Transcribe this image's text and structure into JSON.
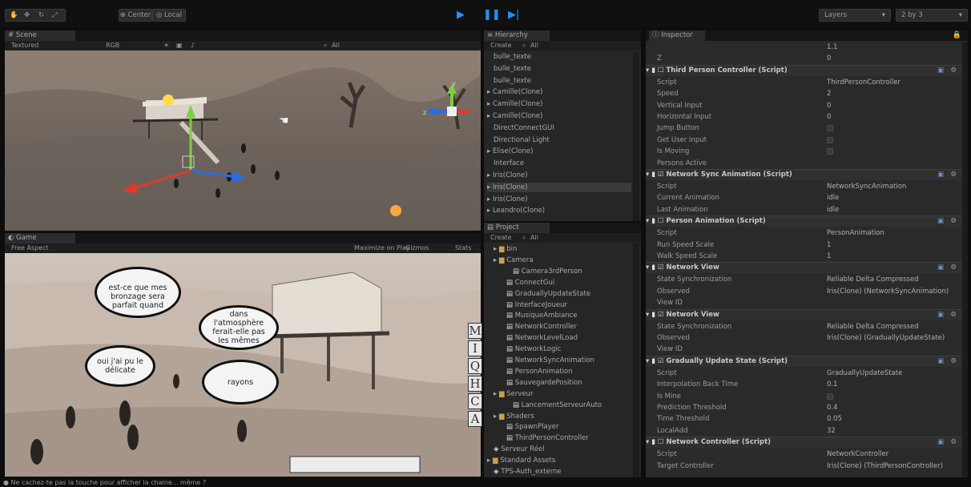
{
  "toolbar": {
    "pivot": "Center",
    "space": "Local",
    "layers": "Layers",
    "layout": "2 by 3"
  },
  "scene": {
    "tab": "Scene",
    "render_mode": "Textured",
    "color_mode": "RGB",
    "search": "All"
  },
  "game": {
    "tab": "Game",
    "aspect": "Free Aspect",
    "maximize": "Maximize on Play",
    "gizmos": "Gizmos",
    "stats": "Stats",
    "bubbles": [
      "est-ce que mes bronzage sera parfait quand",
      "dans l'atmosphère ferait-elle pas les mêmes",
      "oui j'ai pu le délicate",
      "rayons"
    ],
    "keys": [
      "M",
      "I",
      "Q",
      "H",
      "C",
      "A"
    ]
  },
  "hierarchy": {
    "tab": "Hierarchy",
    "create": "Create",
    "search": "All",
    "items": [
      {
        "label": "bulle_texte",
        "arrow": false,
        "selected": false
      },
      {
        "label": "bulle_texte",
        "arrow": false,
        "selected": false
      },
      {
        "label": "bulle_texte",
        "arrow": false,
        "selected": false
      },
      {
        "label": "Camille(Clone)",
        "arrow": true,
        "selected": false
      },
      {
        "label": "Camille(Clone)",
        "arrow": true,
        "selected": false
      },
      {
        "label": "Camille(Clone)",
        "arrow": true,
        "selected": false
      },
      {
        "label": "DirectConnectGUI",
        "arrow": false,
        "selected": false
      },
      {
        "label": "Directional Light",
        "arrow": false,
        "selected": false
      },
      {
        "label": "Elise(Clone)",
        "arrow": true,
        "selected": false
      },
      {
        "label": "Interface",
        "arrow": false,
        "selected": false
      },
      {
        "label": "Iris(Clone)",
        "arrow": true,
        "selected": false
      },
      {
        "label": "Iris(Clone)",
        "arrow": true,
        "selected": true
      },
      {
        "label": "Iris(Clone)",
        "arrow": true,
        "selected": false
      },
      {
        "label": "Leandro(Clone)",
        "arrow": true,
        "selected": false
      }
    ]
  },
  "project": {
    "tab": "Project",
    "create": "Create",
    "search": "All",
    "items": [
      {
        "label": "bin",
        "indent": 1,
        "type": "folder",
        "arrow": true
      },
      {
        "label": "Camera",
        "indent": 1,
        "type": "folder",
        "arrow": true
      },
      {
        "label": "Camera3rdPerson",
        "indent": 3,
        "type": "script",
        "arrow": false
      },
      {
        "label": "ConnectGui",
        "indent": 2,
        "type": "script",
        "arrow": false
      },
      {
        "label": "GraduallyUpdateState",
        "indent": 2,
        "type": "script",
        "arrow": false
      },
      {
        "label": "InterfaceJoueur",
        "indent": 2,
        "type": "script",
        "arrow": false
      },
      {
        "label": "MusiqueAmbiance",
        "indent": 2,
        "type": "script",
        "arrow": false
      },
      {
        "label": "NetworkController",
        "indent": 2,
        "type": "script",
        "arrow": false
      },
      {
        "label": "NetworkLevelLoad",
        "indent": 2,
        "type": "script",
        "arrow": false
      },
      {
        "label": "NetworkLogic",
        "indent": 2,
        "type": "script",
        "arrow": false
      },
      {
        "label": "NetworkSyncAnimation",
        "indent": 2,
        "type": "script",
        "arrow": false
      },
      {
        "label": "PersonAnimation",
        "indent": 2,
        "type": "script",
        "arrow": false
      },
      {
        "label": "SauvegardePosition",
        "indent": 2,
        "type": "script",
        "arrow": false
      },
      {
        "label": "Serveur",
        "indent": 1,
        "type": "folder",
        "arrow": true
      },
      {
        "label": "LancementServeurAuto",
        "indent": 3,
        "type": "script",
        "arrow": false
      },
      {
        "label": "Shaders",
        "indent": 1,
        "type": "folder",
        "arrow": true
      },
      {
        "label": "SpawnPlayer",
        "indent": 2,
        "type": "script",
        "arrow": false
      },
      {
        "label": "ThirdPersonController",
        "indent": 2,
        "type": "script",
        "arrow": false
      },
      {
        "label": "Serveur Réel",
        "indent": 0,
        "type": "scene",
        "arrow": false
      },
      {
        "label": "Standard Assets",
        "indent": 0,
        "type": "folder",
        "arrow": true
      },
      {
        "label": "TPS-Auth_externe",
        "indent": 0,
        "type": "scene",
        "arrow": false
      }
    ]
  },
  "inspector": {
    "tab": "Inspector",
    "rows": [
      {
        "kind": "prop",
        "label": "",
        "value": "1.1"
      },
      {
        "kind": "prop",
        "label": "Z",
        "value": "0"
      },
      {
        "kind": "comp",
        "label": "Third Person Controller (Script)",
        "checked": false
      },
      {
        "kind": "prop",
        "label": "Script",
        "value": "ThirdPersonController"
      },
      {
        "kind": "prop",
        "label": "Speed",
        "value": "2"
      },
      {
        "kind": "prop",
        "label": "Vertical Input",
        "value": "0"
      },
      {
        "kind": "prop",
        "label": "Horizontal Input",
        "value": "0"
      },
      {
        "kind": "check",
        "label": "Jump Button",
        "value": ""
      },
      {
        "kind": "check",
        "label": "Get User Input",
        "value": ""
      },
      {
        "kind": "check",
        "label": "Is Moving",
        "value": ""
      },
      {
        "kind": "prop",
        "label": "Persons Active",
        "value": ""
      },
      {
        "kind": "comp",
        "label": "Network Sync Animation (Script)",
        "checked": true
      },
      {
        "kind": "prop",
        "label": "Script",
        "value": "NetworkSyncAnimation"
      },
      {
        "kind": "prop",
        "label": "Current Animation",
        "value": "idle"
      },
      {
        "kind": "prop",
        "label": "Last Animation",
        "value": "idle"
      },
      {
        "kind": "comp",
        "label": "Person Animation (Script)",
        "checked": false
      },
      {
        "kind": "prop",
        "label": "Script",
        "value": "PersonAnimation"
      },
      {
        "kind": "prop",
        "label": "Run Speed Scale",
        "value": "1"
      },
      {
        "kind": "prop",
        "label": "Walk Speed Scale",
        "value": "1"
      },
      {
        "kind": "comp",
        "label": "Network View",
        "checked": true
      },
      {
        "kind": "prop",
        "label": "State Synchronization",
        "value": "Reliable Delta Compressed"
      },
      {
        "kind": "prop",
        "label": "Observed",
        "value": "Iris(Clone) (NetworkSyncAnimation)"
      },
      {
        "kind": "prop",
        "label": "View ID",
        "value": ""
      },
      {
        "kind": "comp",
        "label": "Network View",
        "checked": true
      },
      {
        "kind": "prop",
        "label": "State Synchronization",
        "value": "Reliable Delta Compressed"
      },
      {
        "kind": "prop",
        "label": "Observed",
        "value": "Iris(Clone) (GraduallyUpdateState)"
      },
      {
        "kind": "prop",
        "label": "View ID",
        "value": ""
      },
      {
        "kind": "comp",
        "label": "Gradually Update State (Script)",
        "checked": true
      },
      {
        "kind": "prop",
        "label": "Script",
        "value": "GraduallyUpdateState"
      },
      {
        "kind": "prop",
        "label": "Interpolation Back Time",
        "value": "0.1"
      },
      {
        "kind": "check",
        "label": "Is Mine",
        "value": ""
      },
      {
        "kind": "prop",
        "label": "Prediction Threshold",
        "value": "0.4"
      },
      {
        "kind": "prop",
        "label": "Time Threshold",
        "value": "0.05"
      },
      {
        "kind": "prop",
        "label": "LocalAdd",
        "value": "32"
      },
      {
        "kind": "comp",
        "label": "Network Controller (Script)",
        "checked": false
      },
      {
        "kind": "prop",
        "label": "Script",
        "value": "NetworkController"
      },
      {
        "kind": "prop",
        "label": "Target Controller",
        "value": "Iris(Clone) (ThirdPersonController)"
      }
    ]
  },
  "status": {
    "text": "Ne cachez-te pas la touche pour afficher la chaine... même ?"
  }
}
